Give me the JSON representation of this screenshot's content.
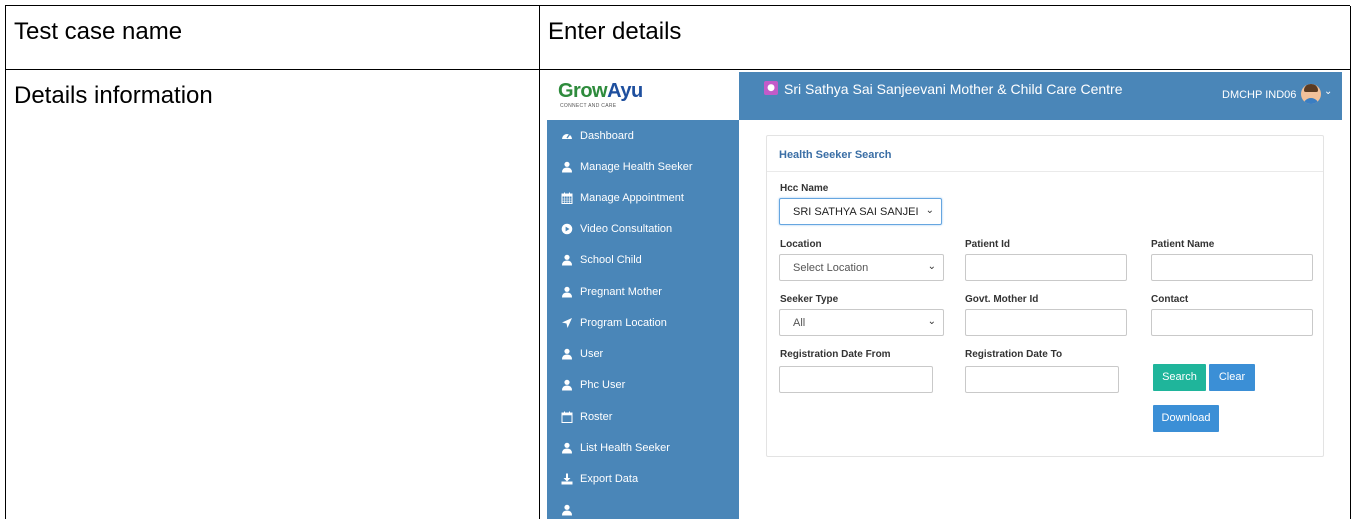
{
  "doc": {
    "row1_col1": "Test case name",
    "row1_col2": "Enter details",
    "row2_col1": "Details information"
  },
  "app": {
    "logo": "GrowAyu",
    "logo_part1": "Grow",
    "logo_part2": "Ayu",
    "logo_tagline": "CONNECT AND CARE",
    "title": "Sri Sathya Sai Sanjeevani Mother & Child Care Centre",
    "user": "DMCHP IND06",
    "colors": {
      "header": "#4a86b8",
      "search": "#1fb59b",
      "clear": "#3b8fd6",
      "card_title": "#3a6ea5"
    }
  },
  "sidebar": {
    "items": [
      {
        "label": "Dashboard",
        "icon": "dashboard-icon"
      },
      {
        "label": "Manage Health Seeker",
        "icon": "user-icon"
      },
      {
        "label": "Manage Appointment",
        "icon": "calendar-icon"
      },
      {
        "label": "Video Consultation",
        "icon": "play-icon"
      },
      {
        "label": "School Child",
        "icon": "user-icon"
      },
      {
        "label": "Pregnant Mother",
        "icon": "user-icon"
      },
      {
        "label": "Program Location",
        "icon": "location-arrow-icon"
      },
      {
        "label": "User",
        "icon": "user-icon"
      },
      {
        "label": "Phc User",
        "icon": "user-icon"
      },
      {
        "label": "Roster",
        "icon": "calendar-outline-icon"
      },
      {
        "label": "List Health Seeker",
        "icon": "user-icon"
      },
      {
        "label": "Export Data",
        "icon": "download-icon"
      }
    ]
  },
  "search": {
    "title": "Health Seeker Search",
    "hcc_label": "Hcc Name",
    "hcc_value": "SRI SATHYA SAI SANJEI",
    "location_label": "Location",
    "location_value": "Select Location",
    "patient_id_label": "Patient Id",
    "patient_id_value": "",
    "patient_name_label": "Patient Name",
    "patient_name_value": "",
    "seeker_type_label": "Seeker Type",
    "seeker_type_value": "All",
    "govt_mother_id_label": "Govt. Mother Id",
    "govt_mother_id_value": "",
    "contact_label": "Contact",
    "contact_value": "",
    "reg_from_label": "Registration Date From",
    "reg_from_value": "",
    "reg_to_label": "Registration Date To",
    "reg_to_value": "",
    "search_button": "Search",
    "clear_button": "Clear",
    "download_button": "Download"
  }
}
